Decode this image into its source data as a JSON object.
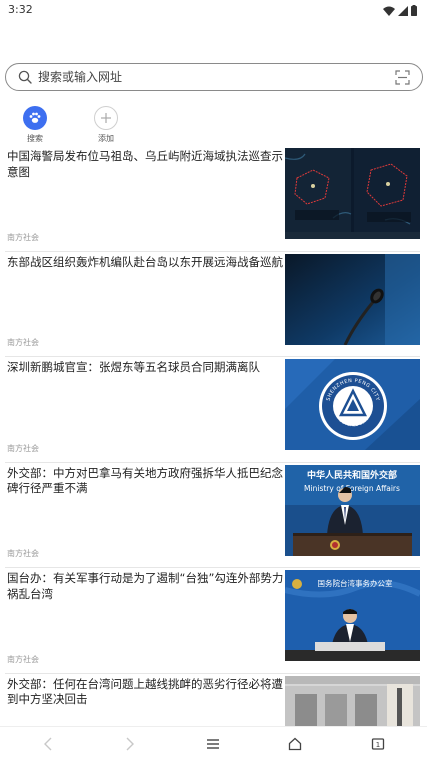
{
  "status": {
    "time": "3:32"
  },
  "search": {
    "placeholder": "搜索或输入网址"
  },
  "quick_links": [
    {
      "label": "搜索",
      "icon": "paw-icon",
      "color": "#3d6ff0"
    },
    {
      "label": "添加",
      "icon": "plus-icon"
    }
  ],
  "news": [
    {
      "title": "中国海警局发布位马祖岛、乌丘屿附近海域执法巡查示意图",
      "source": "南方社会",
      "thumb": "maritime-map"
    },
    {
      "title": "东部战区组织轰炸机编队赴台岛以东开展远海战备巡航",
      "source": "南方社会",
      "thumb": "microphone"
    },
    {
      "title": "深圳新鹏城官宣：张煜东等五名球员合同期满离队",
      "source": "南方社会",
      "thumb": "club-badge",
      "badge_text": "SHENZHEN PENG CITY",
      "badge_sub": "FOOTBALL CLUB"
    },
    {
      "title": "外交部：中方对巴拿马有关地方政府强拆华人抵巴纪念碑行径严重不满",
      "source": "南方社会",
      "thumb": "press-conference",
      "banner_cn": "中华人民共和国外交部",
      "banner_en": "Ministry of Foreign Affairs"
    },
    {
      "title": "国台办：有关军事行动是为了遏制“台独”勾连外部势力祸乱台湾",
      "source": "南方社会",
      "thumb": "press-conference-2",
      "banner_cn": "国务院台湾事务办公室"
    },
    {
      "title": "外交部：任何在台湾问题上越线挑衅的恶劣行径必将遭到中方坚决回击",
      "source": "",
      "thumb": "building"
    }
  ],
  "colors": {
    "accent": "#3d6ff0"
  }
}
